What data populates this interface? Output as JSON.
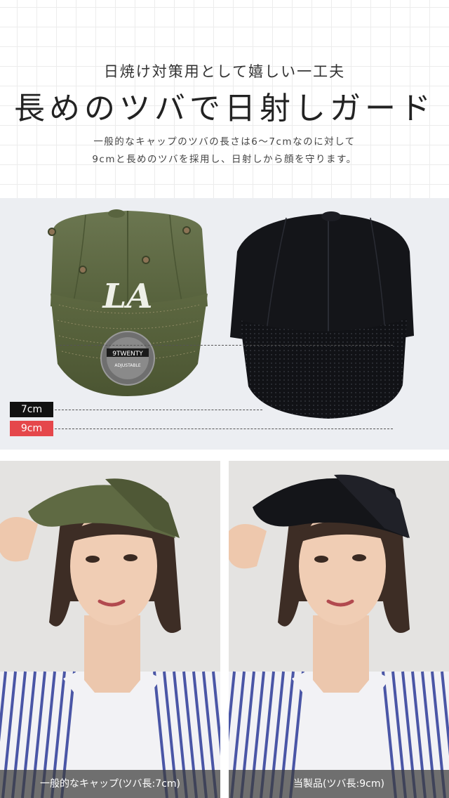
{
  "header": {
    "subhead": "日焼け対策用として嬉しい一工夫",
    "headline": "長めのツバで日射しガード",
    "description_line1": "一般的なキャップのツバの長さは6〜7cmなのに対して",
    "description_line2": "9cmと長めのツバを採用し、日射しから顔を守ります。"
  },
  "comparison": {
    "label_7cm": "7cm",
    "label_9cm": "9cm",
    "label_7cm_color": "#111111",
    "label_9cm_color": "#e5474b",
    "green_cap_color": "#5f6a43",
    "black_cap_color": "#141519",
    "cap_logo": "LA",
    "sticker_line1": "9TWENTY",
    "sticker_line2": "ADJUSTABLE"
  },
  "photos": [
    {
      "caption": "一般的なキャップ(ツバ長:7cm)"
    },
    {
      "caption": "当製品(ツバ長:9cm)"
    }
  ]
}
